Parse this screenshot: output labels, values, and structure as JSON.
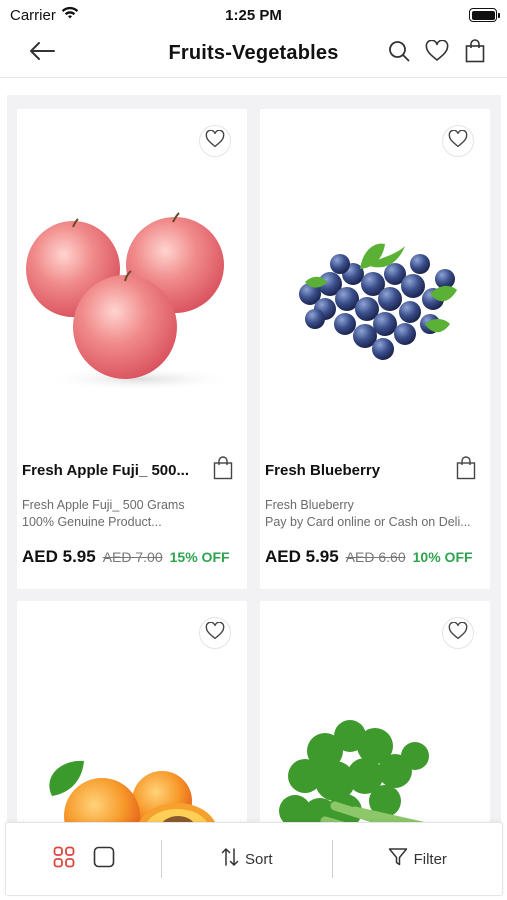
{
  "status_bar": {
    "carrier": "Carrier",
    "time": "1:25 PM"
  },
  "header": {
    "title": "Fruits-Vegetables"
  },
  "products": [
    {
      "name": "Fresh Apple Fuji_ 500...",
      "desc_line1": "Fresh Apple Fuji_ 500 Grams",
      "desc_line2": "100% Genuine Product...",
      "price": "AED 5.95",
      "old_price": "AED 7.00",
      "discount": "15% OFF",
      "image": "apple"
    },
    {
      "name": "Fresh Blueberry",
      "desc_line1": "Fresh Blueberry",
      "desc_line2": "Pay by Card online or Cash on Deli...",
      "price": "AED 5.95",
      "old_price": "AED 6.60",
      "discount": "10% OFF",
      "image": "blueberry"
    },
    {
      "image": "apricot"
    },
    {
      "image": "celery"
    }
  ],
  "toolbar": {
    "sort_label": "Sort",
    "filter_label": "Filter"
  },
  "colors": {
    "accent": "#e0443e",
    "discount": "#2ea44f",
    "background": "#f2f2f4"
  },
  "icons": [
    "back-arrow-icon",
    "search-icon",
    "heart-icon",
    "shopping-bag-icon",
    "grid-view-icon",
    "list-view-icon",
    "sort-icon",
    "filter-icon"
  ]
}
